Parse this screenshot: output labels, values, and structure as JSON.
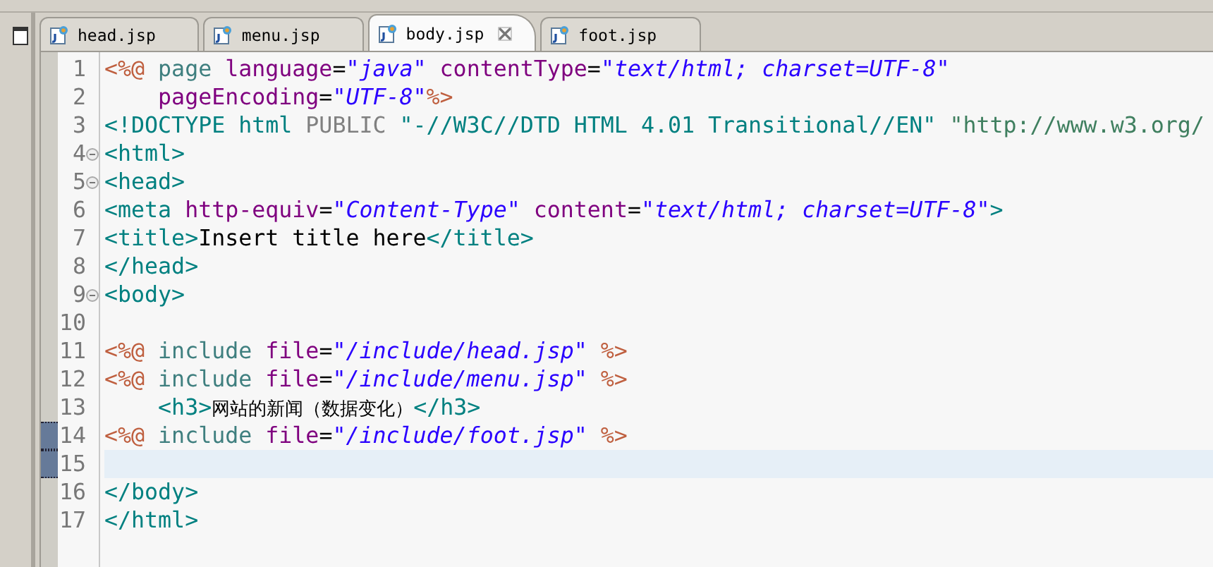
{
  "tabs": [
    {
      "label": "head.jsp",
      "selected": false
    },
    {
      "label": "menu.jsp",
      "selected": false
    },
    {
      "label": "body.jsp",
      "selected": true
    },
    {
      "label": "foot.jsp",
      "selected": false
    }
  ],
  "editor": {
    "lines": [
      {
        "number": "1",
        "fold": false,
        "current": false,
        "marked": false,
        "tokens": [
          {
            "kind": "jsp",
            "text": "<%@ "
          },
          {
            "kind": "directive",
            "text": "page "
          },
          {
            "kind": "attr",
            "text": "language"
          },
          {
            "kind": "punct",
            "text": "="
          },
          {
            "kind": "value",
            "text": "\"java\" "
          },
          {
            "kind": "attr",
            "text": "contentType"
          },
          {
            "kind": "punct",
            "text": "="
          },
          {
            "kind": "value",
            "text": "\"text/html; charset=UTF-8\""
          }
        ]
      },
      {
        "number": "2",
        "fold": false,
        "current": false,
        "marked": false,
        "tokens": [
          {
            "kind": "attr",
            "text": "    pageEncoding"
          },
          {
            "kind": "punct",
            "text": "="
          },
          {
            "kind": "value",
            "text": "\"UTF-8\""
          },
          {
            "kind": "jsp",
            "text": "%>"
          }
        ]
      },
      {
        "number": "3",
        "fold": false,
        "current": false,
        "marked": false,
        "tokens": [
          {
            "kind": "tag",
            "text": "<!DOCTYPE html "
          },
          {
            "kind": "keyword",
            "text": "PUBLIC "
          },
          {
            "kind": "doctype",
            "text": "\"-//W3C//DTD HTML 4.01 Transitional//EN\" "
          },
          {
            "kind": "uri",
            "text": "\"http://www.w3.org/"
          }
        ]
      },
      {
        "number": "4",
        "fold": true,
        "current": false,
        "marked": false,
        "tokens": [
          {
            "kind": "tag",
            "text": "<html>"
          }
        ]
      },
      {
        "number": "5",
        "fold": true,
        "current": false,
        "marked": false,
        "tokens": [
          {
            "kind": "tag",
            "text": "<head>"
          }
        ]
      },
      {
        "number": "6",
        "fold": false,
        "current": false,
        "marked": false,
        "tokens": [
          {
            "kind": "tag",
            "text": "<meta "
          },
          {
            "kind": "attr",
            "text": "http-equiv"
          },
          {
            "kind": "punct",
            "text": "="
          },
          {
            "kind": "value",
            "text": "\"Content-Type\" "
          },
          {
            "kind": "attr",
            "text": "content"
          },
          {
            "kind": "punct",
            "text": "="
          },
          {
            "kind": "value",
            "text": "\"text/html; charset=UTF-8\""
          },
          {
            "kind": "tag",
            "text": ">"
          }
        ]
      },
      {
        "number": "7",
        "fold": false,
        "current": false,
        "marked": false,
        "tokens": [
          {
            "kind": "tag",
            "text": "<title>"
          },
          {
            "kind": "text",
            "text": "Insert title here"
          },
          {
            "kind": "tag",
            "text": "</title>"
          }
        ]
      },
      {
        "number": "8",
        "fold": false,
        "current": false,
        "marked": false,
        "tokens": [
          {
            "kind": "tag",
            "text": "</head>"
          }
        ]
      },
      {
        "number": "9",
        "fold": true,
        "current": false,
        "marked": false,
        "tokens": [
          {
            "kind": "tag",
            "text": "<body>"
          }
        ]
      },
      {
        "number": "10",
        "fold": false,
        "current": false,
        "marked": false
      },
      {
        "number": "11",
        "fold": false,
        "current": false,
        "marked": false,
        "tokens": [
          {
            "kind": "jsp",
            "text": "<%@ "
          },
          {
            "kind": "directive",
            "text": "include "
          },
          {
            "kind": "attr",
            "text": "file"
          },
          {
            "kind": "punct",
            "text": "="
          },
          {
            "kind": "value",
            "text": "\"/include/head.jsp\" "
          },
          {
            "kind": "jsp",
            "text": "%>"
          }
        ]
      },
      {
        "number": "12",
        "fold": false,
        "current": false,
        "marked": false,
        "tokens": [
          {
            "kind": "jsp",
            "text": "<%@ "
          },
          {
            "kind": "directive",
            "text": "include "
          },
          {
            "kind": "attr",
            "text": "file"
          },
          {
            "kind": "punct",
            "text": "="
          },
          {
            "kind": "value",
            "text": "\"/include/menu.jsp\" "
          },
          {
            "kind": "jsp",
            "text": "%>"
          }
        ]
      },
      {
        "number": "13",
        "fold": false,
        "current": false,
        "marked": false,
        "tokens": [
          {
            "kind": "tag",
            "text": "    <h3>"
          },
          {
            "kind": "cjk",
            "text": "网站的新闻（数据变化）"
          },
          {
            "kind": "tag",
            "text": "</h3>"
          }
        ]
      },
      {
        "number": "14",
        "fold": false,
        "current": false,
        "marked": true,
        "tokens": [
          {
            "kind": "jsp",
            "text": "<%@ "
          },
          {
            "kind": "directive",
            "text": "include "
          },
          {
            "kind": "attr",
            "text": "file"
          },
          {
            "kind": "punct",
            "text": "="
          },
          {
            "kind": "value",
            "text": "\"/include/foot.jsp\" "
          },
          {
            "kind": "jsp",
            "text": "%>"
          }
        ]
      },
      {
        "number": "15",
        "fold": false,
        "current": true,
        "marked": true
      },
      {
        "number": "16",
        "fold": false,
        "current": false,
        "marked": false,
        "tokens": [
          {
            "kind": "tag",
            "text": "</body>"
          }
        ]
      },
      {
        "number": "17",
        "fold": false,
        "current": false,
        "marked": false,
        "tokens": [
          {
            "kind": "tag",
            "text": "</html>"
          }
        ]
      }
    ]
  }
}
